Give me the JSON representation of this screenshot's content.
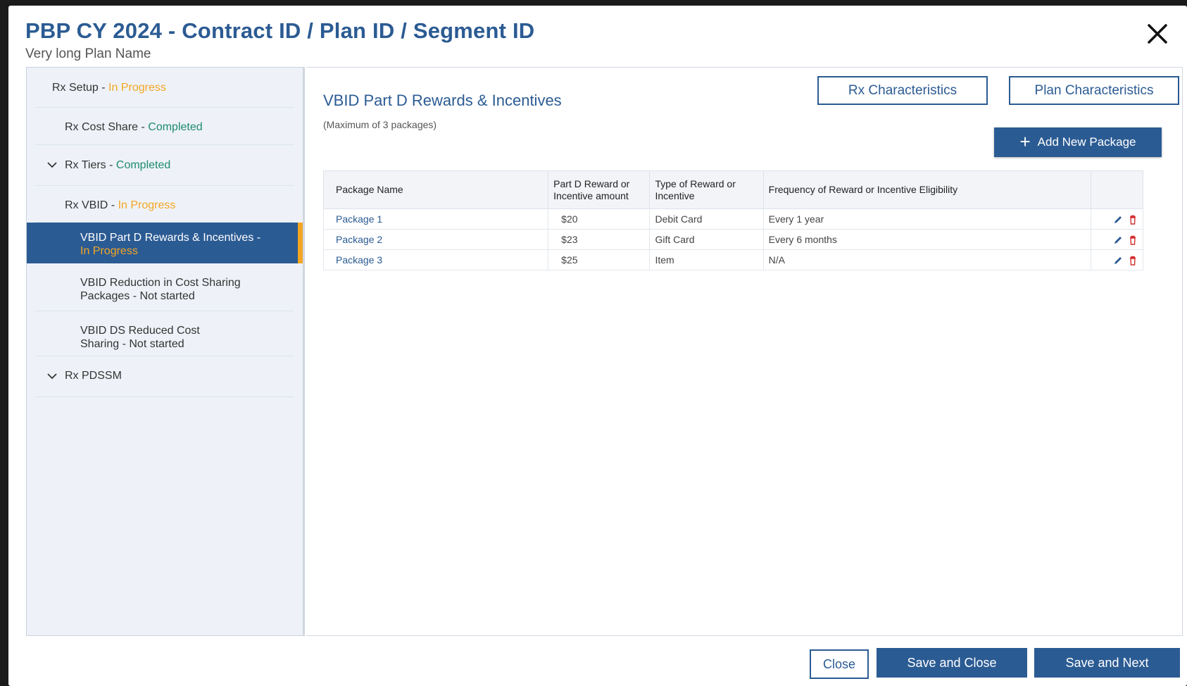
{
  "header": {
    "title": "PBP CY 2024 - Contract ID / Plan ID / Segment ID",
    "subtitle": "Very long Plan Name"
  },
  "sidebar": {
    "items": [
      {
        "label": "Rx Setup - ",
        "status": "In Progress",
        "status_type": "in-progress"
      },
      {
        "label": "Rx Cost Share - ",
        "status": "Completed",
        "status_type": "completed"
      },
      {
        "label": "Rx Tiers - ",
        "status": "Completed",
        "status_type": "completed",
        "expandable": true
      },
      {
        "label": "Rx VBID - ",
        "status": "In Progress",
        "status_type": "in-progress"
      },
      {
        "label": "VBID Part D Rewards & Incentives - ",
        "status": "In Progress",
        "status_type": "in-progress",
        "active": true
      },
      {
        "label": "VBID Reduction in Cost Sharing Packages - Not started"
      },
      {
        "label": "VBID DS Reduced Cost Sharing - Not started"
      },
      {
        "label": "Rx PDSSM",
        "expandable": true
      }
    ]
  },
  "main": {
    "section_title": "VBID Part D  Rewards & Incentives",
    "section_note": "(Maximum of 3 packages)",
    "buttons": {
      "rx_characteristics": "Rx Characteristics",
      "plan_characteristics": "Plan Characteristics",
      "add_new_package": "Add New Package"
    },
    "table": {
      "headers": [
        "Package Name",
        "Part D Reward or Incentive amount",
        "Type of Reward or Incentive",
        "Frequency of Reward or Incentive Eligibility",
        ""
      ],
      "rows": [
        {
          "name": "Package 1",
          "amount": "$20",
          "type": "Debit Card",
          "frequency": "Every 1 year"
        },
        {
          "name": "Package 2",
          "amount": "$23",
          "type": "Gift Card",
          "frequency": "Every 6 months"
        },
        {
          "name": "Package 3",
          "amount": "$25",
          "type": "Item",
          "frequency": "N/A"
        }
      ]
    }
  },
  "footer": {
    "close": "Close",
    "save_and_close": "Save and Close",
    "save_and_next": "Save and Next"
  },
  "colors": {
    "primary": "#2b5b93",
    "in_progress": "#f4a623",
    "completed": "#1e8a6e",
    "delete": "#d32f2f"
  },
  "icons": [
    "close-icon",
    "chevron-down-icon",
    "plus-icon",
    "edit-icon",
    "delete-icon"
  ]
}
